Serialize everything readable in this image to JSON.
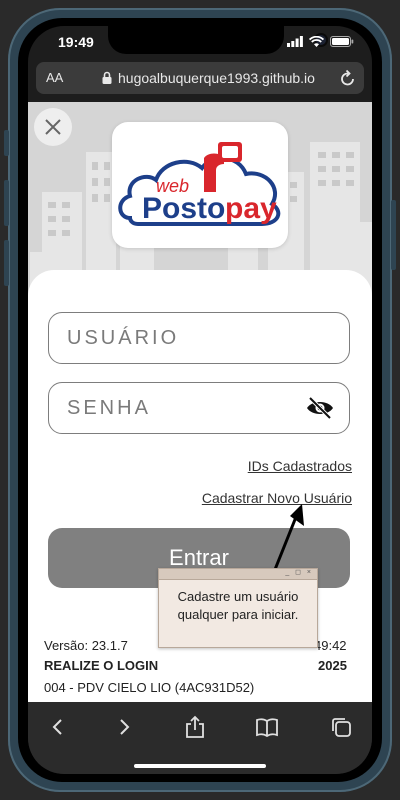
{
  "status_bar": {
    "time": "19:49"
  },
  "browser": {
    "text_size_label": "AA",
    "url": "hugoalbuquerque1993.github.io"
  },
  "logo": {
    "line1": "web",
    "line2_a": "Posto",
    "line2_b": "pay"
  },
  "login": {
    "username_placeholder": "USUÁRIO",
    "password_placeholder": "SENHA",
    "ids_link": "IDs Cadastrados",
    "register_link": "Cadastrar Novo Usuário",
    "enter_label": "Entrar"
  },
  "info": {
    "version_line": "Versão: 23.1.7",
    "version_line_right": "49:42",
    "notice_line": "REALIZE O LOGIN",
    "notice_line_right": "2025",
    "device_line": "004 - PDV CIELO LIO (4AC931D52)"
  },
  "tooltip": {
    "controls": "_ ◻ ×",
    "text_line1": "Cadastre um usuário",
    "text_line2": "qualquer para iniciar."
  },
  "colors": {
    "frame": "#2e4452",
    "logo_blue": "#1d3f8a",
    "logo_red": "#d9262c",
    "button_gray": "#808080"
  },
  "icons": [
    "close-icon",
    "lock-icon",
    "reload-icon",
    "eye-off-icon",
    "back-icon",
    "forward-icon",
    "share-icon",
    "bookmarks-icon",
    "tabs-icon"
  ]
}
